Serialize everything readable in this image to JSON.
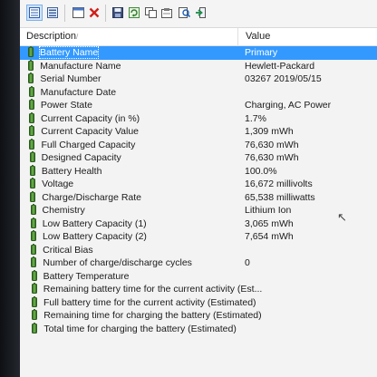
{
  "toolbar": {
    "icons": [
      "view-details-icon",
      "view-list-icon",
      "window-icon",
      "delete-icon",
      "save-icon",
      "refresh-icon",
      "copy-icon",
      "properties-icon",
      "search-icon",
      "exit-icon"
    ]
  },
  "columns": {
    "description": "Description",
    "value": "Value"
  },
  "rows": [
    {
      "label": "Battery Name",
      "value": "Primary",
      "selected": true
    },
    {
      "label": "Manufacture Name",
      "value": "Hewlett-Packard"
    },
    {
      "label": "Serial Number",
      "value": "03267 2019/05/15"
    },
    {
      "label": "Manufacture Date",
      "value": ""
    },
    {
      "label": "Power State",
      "value": "Charging, AC Power"
    },
    {
      "label": "Current Capacity (in %)",
      "value": "1.7%"
    },
    {
      "label": "Current Capacity Value",
      "value": "1,309 mWh"
    },
    {
      "label": "Full Charged Capacity",
      "value": "76,630 mWh"
    },
    {
      "label": "Designed Capacity",
      "value": "76,630 mWh"
    },
    {
      "label": "Battery Health",
      "value": "100.0%"
    },
    {
      "label": "Voltage",
      "value": "16,672 millivolts"
    },
    {
      "label": "Charge/Discharge Rate",
      "value": "65,538 milliwatts"
    },
    {
      "label": "Chemistry",
      "value": "Lithium Ion"
    },
    {
      "label": "Low Battery Capacity (1)",
      "value": "3,065 mWh"
    },
    {
      "label": "Low Battery Capacity (2)",
      "value": "7,654 mWh"
    },
    {
      "label": "Critical Bias",
      "value": ""
    },
    {
      "label": "Number of charge/discharge cycles",
      "value": "0"
    },
    {
      "label": "Battery Temperature",
      "value": ""
    },
    {
      "label": "Remaining battery time for the current activity (Est...",
      "value": ""
    },
    {
      "label": "Full battery time for the current activity (Estimated)",
      "value": ""
    },
    {
      "label": "Remaining time for charging the battery (Estimated)",
      "value": ""
    },
    {
      "label": "Total  time for charging the battery (Estimated)",
      "value": ""
    }
  ]
}
